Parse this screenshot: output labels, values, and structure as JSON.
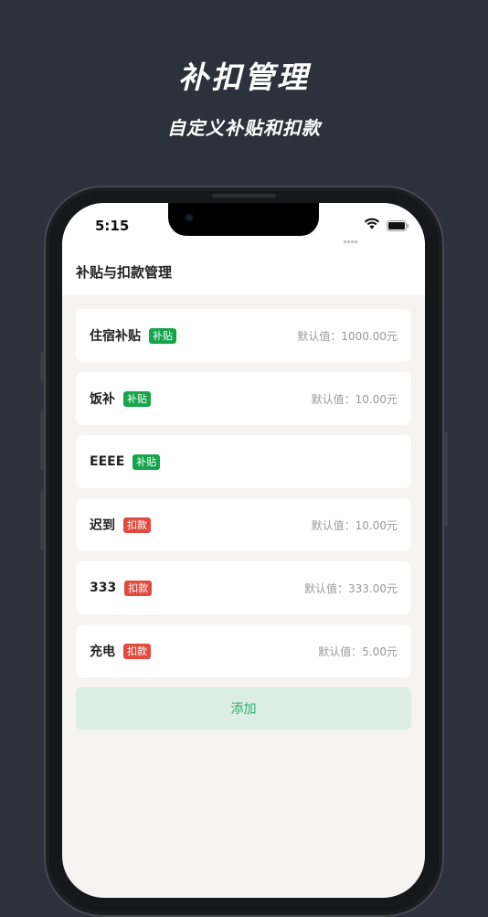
{
  "promo": {
    "title": "补扣管理",
    "subtitle": "自定义补贴和扣款"
  },
  "status_bar": {
    "time": "5:15"
  },
  "header": {
    "title": "补贴与扣款管理"
  },
  "items": [
    {
      "name": "住宿补贴",
      "tag": "补贴",
      "type": "subsidy",
      "default_text": "默认值：1000.00元"
    },
    {
      "name": "饭补",
      "tag": "补贴",
      "type": "subsidy",
      "default_text": "默认值：10.00元"
    },
    {
      "name": "EEEE",
      "tag": "补贴",
      "type": "subsidy",
      "default_text": ""
    },
    {
      "name": "迟到",
      "tag": "扣款",
      "type": "deduction",
      "default_text": "默认值：10.00元"
    },
    {
      "name": "333",
      "tag": "扣款",
      "type": "deduction",
      "default_text": "默认值：333.00元"
    },
    {
      "name": "充电",
      "tag": "扣款",
      "type": "deduction",
      "default_text": "默认值：5.00元"
    }
  ],
  "add_button": {
    "label": "添加"
  },
  "colors": {
    "subsidy": "#16a34a",
    "deduction": "#e04b3f",
    "background": "#2c313b"
  },
  "icons": {
    "signal": "signal-icon",
    "wifi": "wifi-icon",
    "battery": "battery-icon"
  }
}
